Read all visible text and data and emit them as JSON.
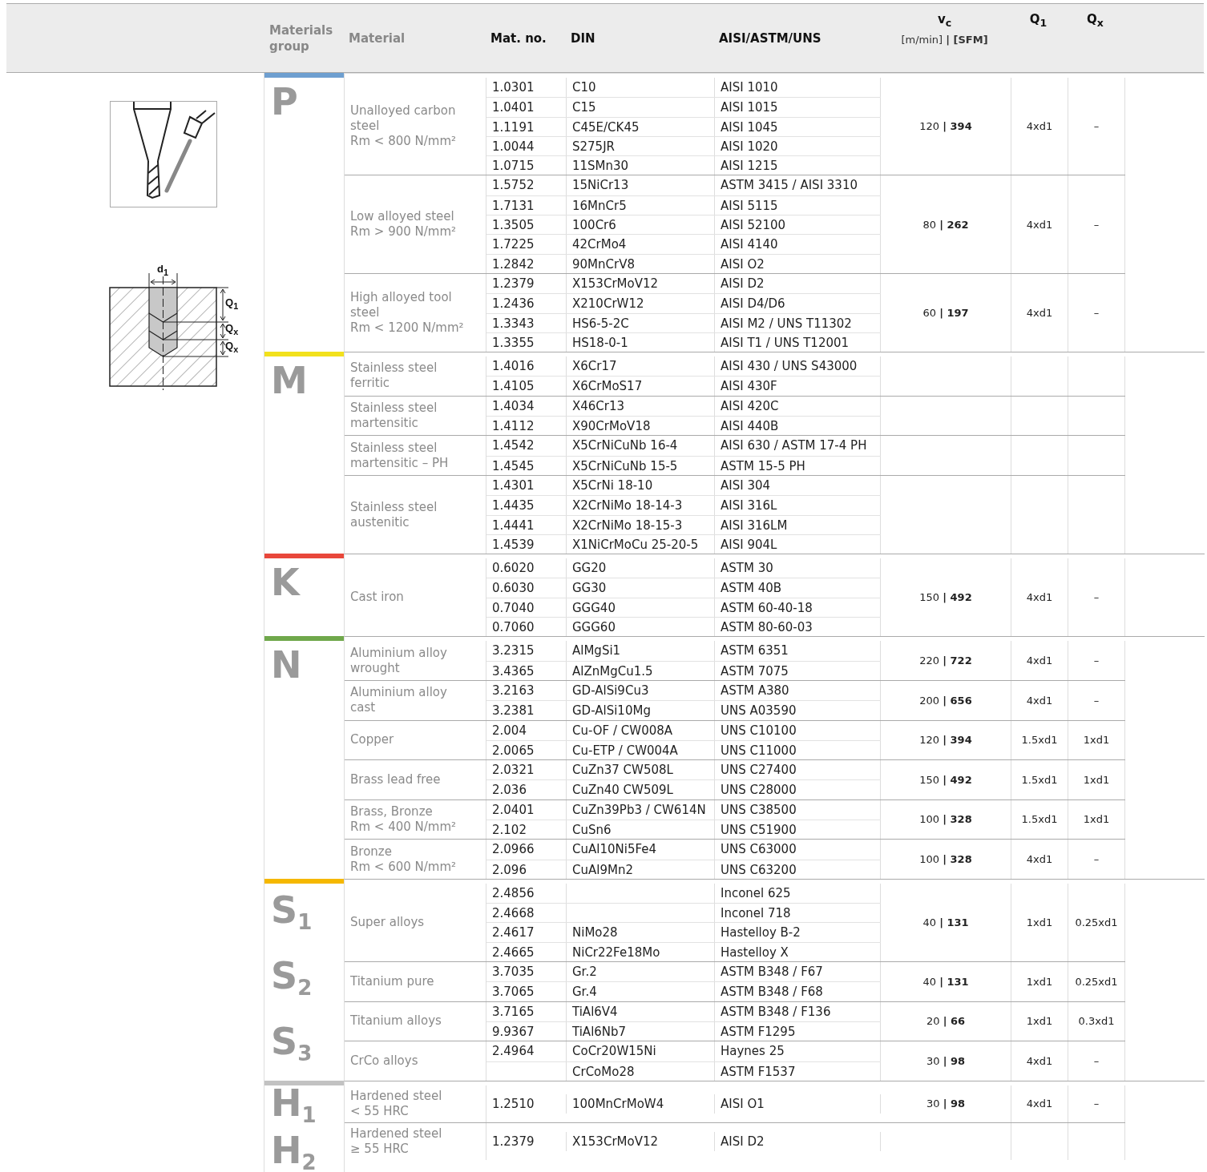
{
  "header": {
    "columns": [
      "Materials group",
      "Material",
      "Mat. no.",
      "DIN",
      "AISI/ASTM/UNS"
    ],
    "vc": {
      "label": "v$_{c}$",
      "unit": "[m/min] **| [SFM]**"
    },
    "q1": "Q$_{1}$",
    "qx": "Q$_{x}$"
  },
  "figure": {
    "labels": [
      "d$_{1}$",
      "Q$_{1}$",
      "Q$_{x}$",
      "Q$_{x}$"
    ]
  },
  "groups": [
    {
      "color": "#6e9fd0",
      "letters": [
        "P"
      ],
      "materials": [
        {
          "name": "Unalloyed carbon steel",
          "spec": "Rm < 800 N/mm²",
          "vc": "120 **| 394**",
          "q1": "4xd1",
          "qx": "–",
          "rows": [
            {
              "mat_no": "1.0301",
              "din": "C10",
              "aisi": "AISI 1010"
            },
            {
              "mat_no": "1.0401",
              "din": "C15",
              "aisi": "AISI 1015"
            },
            {
              "mat_no": "1.1191",
              "din": "C45E/CK45",
              "aisi": "AISI 1045"
            },
            {
              "mat_no": "1.0044",
              "din": "S275JR",
              "aisi": "AISI 1020"
            },
            {
              "mat_no": "1.0715",
              "din": "11SMn30",
              "aisi": "AISI 1215"
            }
          ]
        },
        {
          "name": "Low alloyed steel",
          "spec": "Rm > 900 N/mm²",
          "vc": "80 **| 262**",
          "q1": "4xd1",
          "qx": "–",
          "rows": [
            {
              "mat_no": "1.5752",
              "din": "15NiCr13",
              "aisi": "ASTM 3415 / AISI 3310"
            },
            {
              "mat_no": "1.7131",
              "din": "16MnCr5",
              "aisi": "AISI 5115"
            },
            {
              "mat_no": "1.3505",
              "din": "100Cr6",
              "aisi": "AISI 52100"
            },
            {
              "mat_no": "1.7225",
              "din": "42CrMo4",
              "aisi": "AISI 4140"
            },
            {
              "mat_no": "1.2842",
              "din": "90MnCrV8",
              "aisi": "AISI O2"
            }
          ]
        },
        {
          "name": "High alloyed tool steel",
          "spec": "Rm < 1200 N/mm²",
          "vc": "60 **| 197**",
          "q1": "4xd1",
          "qx": "–",
          "rows": [
            {
              "mat_no": "1.2379",
              "din": "X153CrMoV12",
              "aisi": "AISI D2"
            },
            {
              "mat_no": "1.2436",
              "din": "X210CrW12",
              "aisi": "AISI D4/D6"
            },
            {
              "mat_no": "1.3343",
              "din": "HS6-5-2C",
              "aisi": "AISI M2 / UNS T11302"
            },
            {
              "mat_no": "1.3355",
              "din": "HS18-0-1",
              "aisi": "AISI T1 / UNS T12001"
            }
          ]
        }
      ]
    },
    {
      "color": "#f2e11c",
      "letters": [
        "M"
      ],
      "materials": [
        {
          "name": "Stainless steel ferritic",
          "rows": [
            {
              "mat_no": "1.4016",
              "din": "X6Cr17",
              "aisi": "AISI 430 / UNS S43000"
            },
            {
              "mat_no": "1.4105",
              "din": "X6CrMoS17",
              "aisi": "AISI 430F"
            }
          ]
        },
        {
          "name": "Stainless steel martensitic",
          "rows": [
            {
              "mat_no": "1.4034",
              "din": "X46Cr13",
              "aisi": "AISI 420C"
            },
            {
              "mat_no": "1.4112",
              "din": "X90CrMoV18",
              "aisi": "AISI 440B"
            }
          ]
        },
        {
          "name": "Stainless steel martensitic – PH",
          "rows": [
            {
              "mat_no": "1.4542",
              "din": "X5CrNiCuNb 16-4",
              "aisi": "AISI 630 / ASTM 17-4 PH"
            },
            {
              "mat_no": "1.4545",
              "din": "X5CrNiCuNb 15-5",
              "aisi": "ASTM 15-5 PH"
            }
          ]
        },
        {
          "name": "Stainless steel austenitic",
          "rows": [
            {
              "mat_no": "1.4301",
              "din": "X5CrNi 18-10",
              "aisi": "AISI 304"
            },
            {
              "mat_no": "1.4435",
              "din": "X2CrNiMo 18-14-3",
              "aisi": "AISI 316L"
            },
            {
              "mat_no": "1.4441",
              "din": "X2CrNiMo 18-15-3",
              "aisi": "AISI 316LM"
            },
            {
              "mat_no": "1.4539",
              "din": "X1NiCrMoCu 25-20-5",
              "aisi": "AISI 904L"
            }
          ]
        }
      ]
    },
    {
      "color": "#e8473b",
      "letters": [
        "K"
      ],
      "materials": [
        {
          "name": "Cast iron",
          "vc": "150 **| 492**",
          "q1": "4xd1",
          "qx": "–",
          "rows": [
            {
              "mat_no": "0.6020",
              "din": "GG20",
              "aisi": "ASTM 30"
            },
            {
              "mat_no": "0.6030",
              "din": "GG30",
              "aisi": "ASTM 40B"
            },
            {
              "mat_no": "0.7040",
              "din": "GGG40",
              "aisi": "ASTM 60-40-18"
            },
            {
              "mat_no": "0.7060",
              "din": "GGG60",
              "aisi": "ASTM 80-60-03"
            }
          ]
        }
      ]
    },
    {
      "color": "#6fa84b",
      "letters": [
        "N"
      ],
      "materials": [
        {
          "name": "Aluminium alloy wrought",
          "vc": "220 **| 722**",
          "q1": "4xd1",
          "qx": "–",
          "rows": [
            {
              "mat_no": "3.2315",
              "din": "AlMgSi1",
              "aisi": "ASTM 6351"
            },
            {
              "mat_no": "3.4365",
              "din": "AlZnMgCu1.5",
              "aisi": "ASTM 7075"
            }
          ]
        },
        {
          "name": "Aluminium alloy cast",
          "vc": "200 **| 656**",
          "q1": "4xd1",
          "qx": "–",
          "rows": [
            {
              "mat_no": "3.2163",
              "din": "GD-AlSi9Cu3",
              "aisi": "ASTM A380"
            },
            {
              "mat_no": "3.2381",
              "din": "GD-AlSi10Mg",
              "aisi": "UNS A03590"
            }
          ]
        },
        {
          "name": "Copper",
          "vc": "120 **| 394**",
          "q1": "1.5xd1",
          "qx": "1xd1",
          "rows": [
            {
              "mat_no": "2.004",
              "din": "Cu-OF / CW008A",
              "aisi": "UNS C10100"
            },
            {
              "mat_no": "2.0065",
              "din": "Cu-ETP / CW004A",
              "aisi": "UNS C11000"
            }
          ]
        },
        {
          "name": "Brass lead free",
          "vc": "150 **| 492**",
          "q1": "1.5xd1",
          "qx": "1xd1",
          "rows": [
            {
              "mat_no": "2.0321",
              "din": "CuZn37 CW508L",
              "aisi": "UNS C27400"
            },
            {
              "mat_no": "2.036",
              "din": "CuZn40 CW509L",
              "aisi": "UNS C28000"
            }
          ]
        },
        {
          "name": "Brass, Bronze",
          "spec": "Rm < 400 N/mm²",
          "vc": "100 **| 328**",
          "q1": "1.5xd1",
          "qx": "1xd1",
          "rows": [
            {
              "mat_no": "2.0401",
              "din": "CuZn39Pb3 / CW614N",
              "aisi": "UNS C38500"
            },
            {
              "mat_no": "2.102",
              "din": "CuSn6",
              "aisi": "UNS C51900"
            }
          ]
        },
        {
          "name": "Bronze",
          "spec": "Rm < 600 N/mm²",
          "vc": "100 **| 328**",
          "q1": "4xd1",
          "qx": "–",
          "rows": [
            {
              "mat_no": "2.0966",
              "din": "CuAl10Ni5Fe4",
              "aisi": "UNS C63000"
            },
            {
              "mat_no": "2.096",
              "din": "CuAl9Mn2",
              "aisi": "UNS C63200"
            }
          ]
        }
      ]
    },
    {
      "color": "#f5b800",
      "letters": [
        "S$_{1}$",
        "S$_{2}$",
        "S$_{3}$"
      ],
      "materials": [
        {
          "name": "Super alloys",
          "vc": "40 **| 131**",
          "q1": "1xd1",
          "qx": "0.25xd1",
          "rows": [
            {
              "mat_no": "2.4856",
              "aisi": "Inconel 625"
            },
            {
              "mat_no": "2.4668",
              "aisi": "Inconel 718"
            },
            {
              "mat_no": "2.4617",
              "din": "NiMo28",
              "aisi": "Hastelloy B-2"
            },
            {
              "mat_no": "2.4665",
              "din": "NiCr22Fe18Mo",
              "aisi": "Hastelloy X"
            }
          ]
        },
        {
          "name": "Titanium pure",
          "vc": "40 **| 131**",
          "q1": "1xd1",
          "qx": "0.25xd1",
          "rows": [
            {
              "mat_no": "3.7035",
              "din": "Gr.2",
              "aisi": "ASTM B348 / F67"
            },
            {
              "mat_no": "3.7065",
              "din": "Gr.4",
              "aisi": "ASTM B348 / F68"
            }
          ]
        },
        {
          "name": "Titanium alloys",
          "vc": "20 **| 66**",
          "q1": "1xd1",
          "qx": "0.3xd1",
          "rows": [
            {
              "mat_no": "3.7165",
              "din": "TiAl6V4",
              "aisi": "ASTM B348 / F136"
            },
            {
              "mat_no": "9.9367",
              "din": "TiAl6Nb7",
              "aisi": "ASTM F1295"
            }
          ]
        },
        {
          "name": "CrCo alloys",
          "vc": "30 **| 98**",
          "q1": "4xd1",
          "qx": "–",
          "rows": [
            {
              "mat_no": "2.4964",
              "din": "CoCr20W15Ni",
              "aisi": "Haynes 25"
            },
            {
              "din": "CrCoMo28",
              "aisi": "ASTM F1537"
            }
          ]
        }
      ]
    },
    {
      "color": "#c2c2c2",
      "letters": [
        "H$_{1}$",
        "H$_{2}$"
      ],
      "materials": [
        {
          "name": "Hardened steel",
          "spec": "< 55 HRC",
          "vc": "30 **| 98**",
          "q1": "4xd1",
          "qx": "–",
          "rows": [
            {
              "mat_no": "1.2510",
              "din": "100MnCrMoW4",
              "aisi": "AISI O1"
            }
          ]
        },
        {
          "name": "Hardened steel",
          "spec": "≥ 55 HRC",
          "rows": [
            {
              "mat_no": "1.2379",
              "din": "X153CrMoV12",
              "aisi": "AISI D2"
            }
          ]
        }
      ]
    }
  ]
}
